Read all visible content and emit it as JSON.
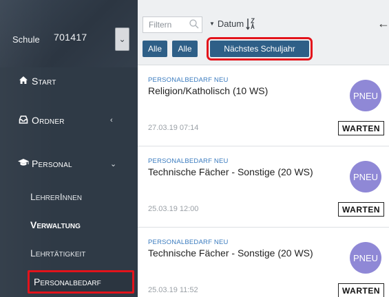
{
  "sidebar": {
    "school_label": "Schule",
    "school_id": "701417",
    "nav": [
      {
        "label": "Start",
        "icon": "home-icon"
      },
      {
        "label": "Ordner",
        "icon": "inbox-icon",
        "chevron": "‹"
      },
      {
        "label": "Personal",
        "icon": "graduation-cap-icon",
        "chevron": "⌄"
      }
    ],
    "sub_items": [
      "LehrerInnen",
      "Verwaltung",
      "Lehrtätigkeit",
      "Personalbedarf"
    ],
    "colors": {
      "background": "#2f3a46",
      "highlight_border": "#e3131b"
    }
  },
  "toolbar": {
    "filter_placeholder": "Filtern",
    "sort_label": "Datum",
    "buttons": [
      "Alle",
      "Alle",
      "Nächstes Schuljahr"
    ],
    "colors": {
      "button": "#2e5f87"
    }
  },
  "cards": [
    {
      "type": "PERSONALBEDARF NEU",
      "title": "Religion/Katholisch (10 WS)",
      "avatar": "PNEU",
      "date": "27.03.19 07:14",
      "status": "WARTEN"
    },
    {
      "type": "PERSONALBEDARF NEU",
      "title": "Technische Fächer - Sonstige (20 WS)",
      "avatar": "PNEU",
      "date": "25.03.19 12:00",
      "status": "WARTEN"
    },
    {
      "type": "PERSONALBEDARF NEU",
      "title": "Technische Fächer - Sonstige (20 WS)",
      "avatar": "PNEU",
      "date": "25.03.19 11:52",
      "status": "WARTEN"
    }
  ]
}
